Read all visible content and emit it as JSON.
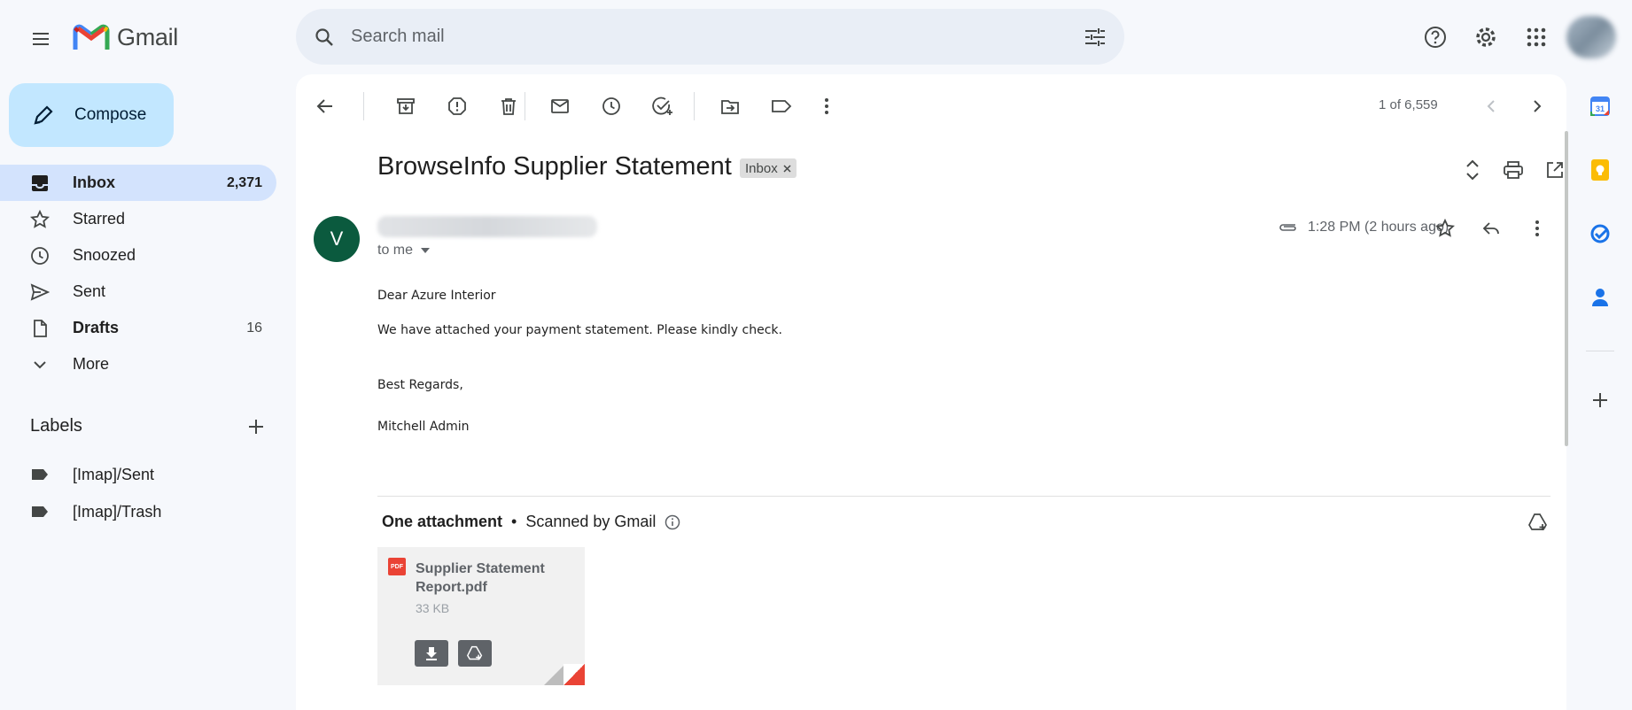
{
  "app": {
    "name": "Gmail"
  },
  "search": {
    "placeholder": "Search mail"
  },
  "compose": {
    "label": "Compose"
  },
  "nav": {
    "items": [
      {
        "label": "Inbox",
        "count": "2,371"
      },
      {
        "label": "Starred",
        "count": ""
      },
      {
        "label": "Snoozed",
        "count": ""
      },
      {
        "label": "Sent",
        "count": ""
      },
      {
        "label": "Drafts",
        "count": "16"
      },
      {
        "label": "More",
        "count": ""
      }
    ]
  },
  "labels": {
    "title": "Labels",
    "items": [
      "[Imap]/Sent",
      "[Imap]/Trash"
    ]
  },
  "toolbar": {
    "pager": "1 of 6,559"
  },
  "message": {
    "subject": "BrowseInfo Supplier Statement",
    "label_chip": "Inbox",
    "sender_initial": "V",
    "recipient": "to me",
    "time": "1:28 PM (2 hours ago)",
    "body": [
      "Dear Azure Interior",
      "We have attached your payment statement. Please kindly check.",
      "Best Regards,",
      "Mitchell Admin"
    ]
  },
  "attachments": {
    "heading": "One attachment",
    "scanned": "Scanned by Gmail",
    "files": [
      {
        "name": "Supplier Statement Report.pdf",
        "size": "33 KB",
        "type_badge": "PDF"
      }
    ]
  },
  "colors": {
    "compose_bg": "#c2e7ff",
    "active_nav": "#d3e3fd",
    "avatar_bg": "#0b5a3e",
    "pdf_red": "#ea4335"
  }
}
